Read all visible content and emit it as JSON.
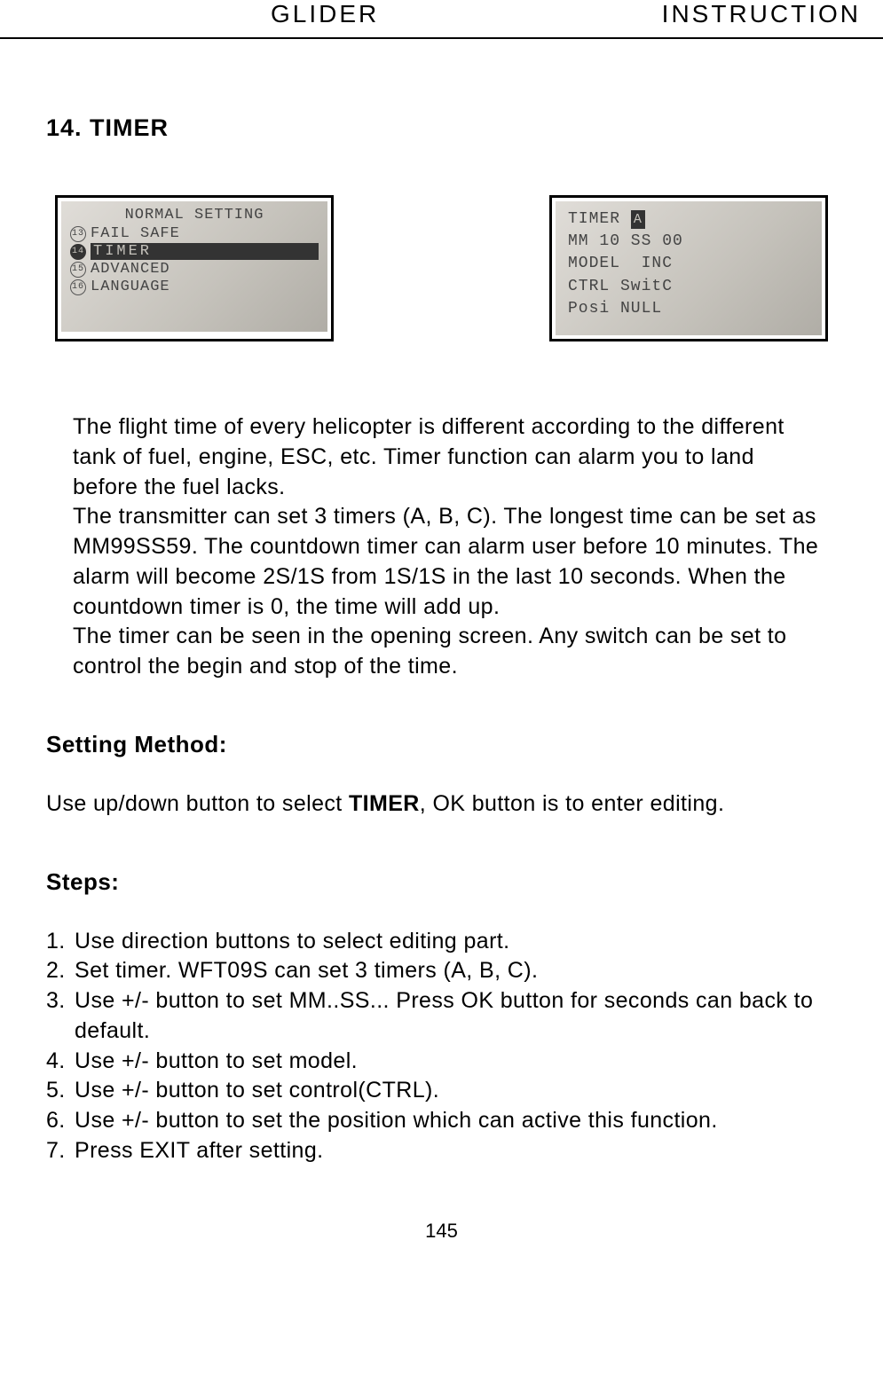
{
  "header": {
    "left": "GLIDER",
    "right": "INSTRUCTION"
  },
  "section_title": "14. TIMER",
  "lcd_left": {
    "title": "NORMAL SETTING",
    "items": [
      {
        "num": "13",
        "label": "FAIL SAFE",
        "selected": false
      },
      {
        "num": "14",
        "label": "TIMER",
        "selected": true
      },
      {
        "num": "15",
        "label": "ADVANCED",
        "selected": false
      },
      {
        "num": "16",
        "label": "LANGUAGE",
        "selected": false
      }
    ]
  },
  "lcd_right": {
    "line1_prefix": "TIMER ",
    "line1_badge": "A",
    "line2": "MM 10 SS 00",
    "line3": "MODEL  INC",
    "line4": "CTRL SwitC",
    "line5": "Posi NULL"
  },
  "body_paragraphs": {
    "p1": "The flight time of every helicopter is different according to the different tank of fuel, engine, ESC, etc. Timer function can alarm you to land before the fuel lacks.",
    "p2": "The transmitter can set 3 timers (A, B, C). The longest time can be set as MM99SS59. The countdown timer can alarm user before 10 minutes. The alarm will become 2S/1S from 1S/1S  in the last 10 seconds. When the countdown timer is 0, the time will add up.",
    "p3": "The timer can be seen in the opening screen. Any switch can be set to control the begin and stop of the time."
  },
  "setting_method_heading": "Setting Method:",
  "setting_method_text_pre": "Use up/down button to select ",
  "setting_method_text_bold": "TIMER",
  "setting_method_text_post": ", OK button is to enter  editing.",
  "steps_heading": "Steps:",
  "steps": [
    {
      "num": "1.",
      "text": "Use direction buttons to select editing part."
    },
    {
      "num": "2.",
      "text": "Set timer. WFT09S can set 3 timers (A, B, C)."
    },
    {
      "num": "3.",
      "text": "Use +/- button to set MM..SS... Press OK button for seconds can back to default."
    },
    {
      "num": "4.",
      "text": "Use +/- button to set model."
    },
    {
      "num": "5.",
      "text": "Use +/- button to set control(CTRL)."
    },
    {
      "num": "6.",
      "text": "Use +/- button to set the position which can  active this function."
    },
    {
      "num": "7.",
      "text": "Press EXIT after setting."
    }
  ],
  "page_number": "145"
}
